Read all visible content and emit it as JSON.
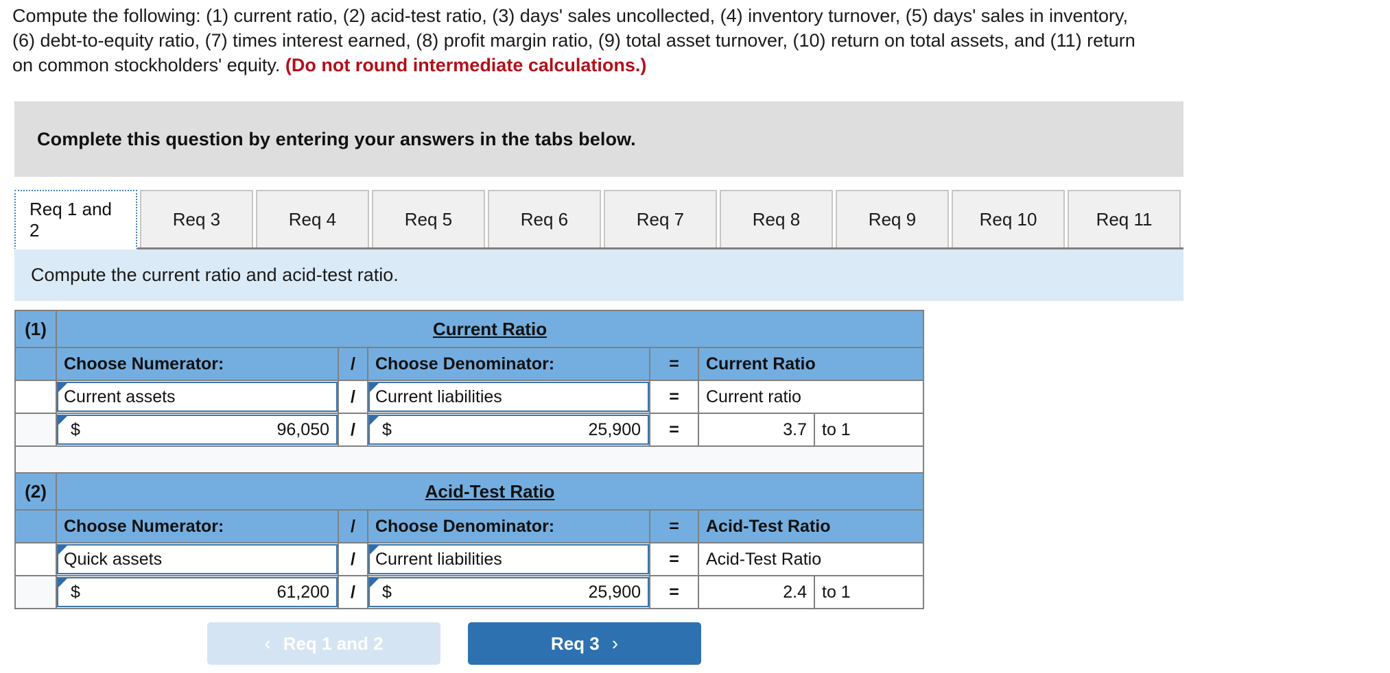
{
  "prompt": {
    "line1": "Compute the following: (1) current ratio, (2) acid-test ratio, (3) days' sales uncollected, (4) inventory turnover, (5) days' sales in inventory,",
    "line2": "(6) debt-to-equity ratio, (7) times interest earned, (8) profit margin ratio, (9) total asset turnover, (10) return on total assets, and (11) return",
    "line3_before": "on common stockholders' equity. ",
    "line3_emph": "(Do not round intermediate calculations.)"
  },
  "banner": {
    "text": "Complete this question by entering your answers in the tabs below."
  },
  "tabs": [
    {
      "label": "Req 1 and 2",
      "active": true
    },
    {
      "label": "Req 3",
      "active": false
    },
    {
      "label": "Req 4",
      "active": false
    },
    {
      "label": "Req 5",
      "active": false
    },
    {
      "label": "Req 6",
      "active": false
    },
    {
      "label": "Req 7",
      "active": false
    },
    {
      "label": "Req 8",
      "active": false
    },
    {
      "label": "Req 9",
      "active": false
    },
    {
      "label": "Req 10",
      "active": false
    },
    {
      "label": "Req 11",
      "active": false
    }
  ],
  "instruction": {
    "text": "Compute the current ratio and acid-test ratio."
  },
  "tables": [
    {
      "index_label": "(1)",
      "title": "Current Ratio",
      "headers": {
        "numerator": "Choose Numerator:",
        "divide": "/",
        "denominator": "Choose Denominator:",
        "equals": "=",
        "result": "Current Ratio"
      },
      "row_labels": {
        "numerator": "Current assets",
        "divide": "/",
        "denominator": "Current liabilities",
        "equals": "=",
        "result": "Current ratio"
      },
      "row_values": {
        "numerator_currency": "$",
        "numerator_amount": "96,050",
        "divide": "/",
        "denominator_currency": "$",
        "denominator_amount": "25,900",
        "equals": "=",
        "result_value": "3.7",
        "result_unit": "to 1"
      }
    },
    {
      "index_label": "(2)",
      "title": "Acid-Test Ratio",
      "headers": {
        "numerator": "Choose Numerator:",
        "divide": "/",
        "denominator": "Choose Denominator:",
        "equals": "=",
        "result": "Acid-Test Ratio"
      },
      "row_labels": {
        "numerator": "Quick assets",
        "divide": "/",
        "denominator": "Current liabilities",
        "equals": "=",
        "result": "Acid-Test Ratio"
      },
      "row_values": {
        "numerator_currency": "$",
        "numerator_amount": "61,200",
        "divide": "/",
        "denominator_currency": "$",
        "denominator_amount": "25,900",
        "equals": "=",
        "result_value": "2.4",
        "result_unit": "to 1"
      }
    }
  ],
  "footer": {
    "prev_label": "Req 1 and 2",
    "prev_chevron": "‹",
    "next_label": "Req 3",
    "next_chevron": "›"
  },
  "colors": {
    "header_blue": "#74aee0",
    "band_blue": "#dbeaf7",
    "banner_gray": "#dedede",
    "accent_blue": "#2e71b0",
    "field_border": "#3a74ae",
    "emph_red": "#b3101a"
  }
}
